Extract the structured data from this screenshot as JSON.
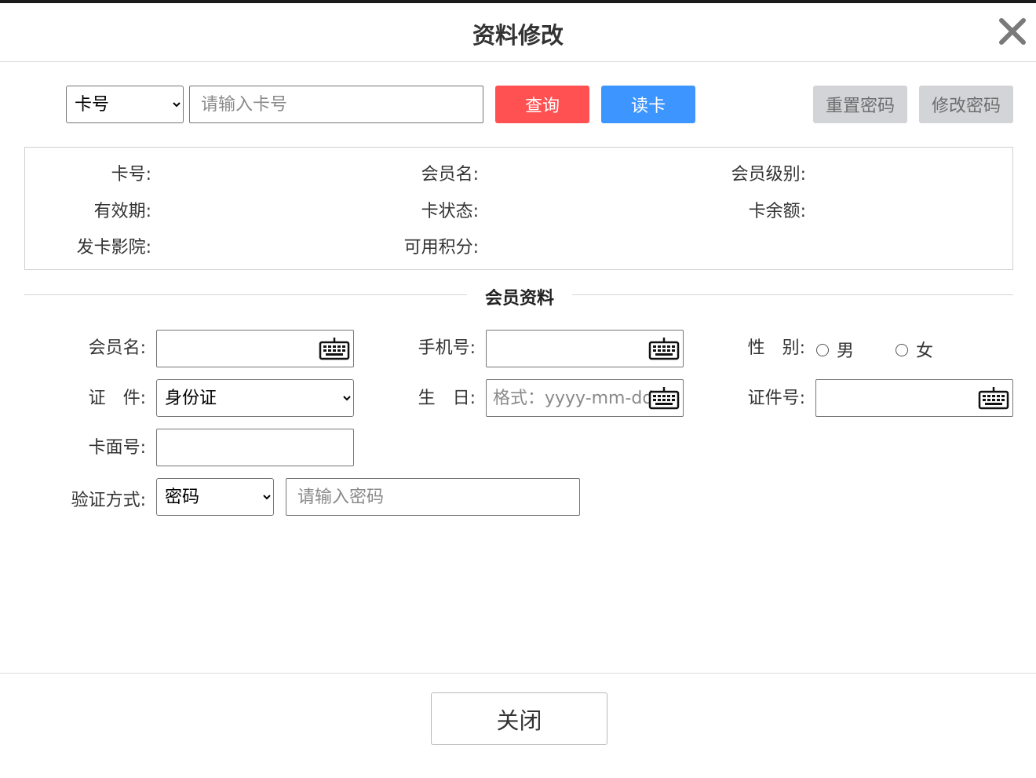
{
  "dialog": {
    "title": "资料修改",
    "close_icon": "close-x-icon"
  },
  "search": {
    "type_options": [
      "卡号"
    ],
    "type_selected": "卡号",
    "card_placeholder": "请输入卡号",
    "query_label": "查询",
    "read_card_label": "读卡",
    "reset_password_label": "重置密码",
    "change_password_label": "修改密码"
  },
  "card_info": {
    "card_no_label": "卡号:",
    "member_name_label": "会员名:",
    "member_level_label": "会员级别:",
    "valid_period_label": "有效期:",
    "card_status_label": "卡状态:",
    "card_balance_label": "卡余额:",
    "issuing_cinema_label": "发卡影院:",
    "available_points_label": "可用积分:"
  },
  "member_section": {
    "title": "会员资料",
    "member_name_label": "会员名:",
    "mobile_label": "手机号:",
    "gender_label": "性　别:",
    "gender_male": "男",
    "gender_female": "女",
    "id_type_label": "证　件:",
    "id_type_options": [
      "身份证"
    ],
    "id_type_selected": "身份证",
    "birthday_label": "生　日:",
    "birthday_placeholder": "格式：yyyy-mm-dd",
    "id_number_label": "证件号:",
    "card_face_no_label": "卡面号:",
    "verify_method_label": "验证方式:",
    "verify_options": [
      "密码"
    ],
    "verify_selected": "密码",
    "password_placeholder": "请输入密码",
    "keyboard_icon": "keyboard-icon"
  },
  "footer": {
    "close_label": "关闭"
  },
  "colors": {
    "query": "#ff5052",
    "read_card": "#3d95ff",
    "disabled": "#d2d4d7"
  }
}
